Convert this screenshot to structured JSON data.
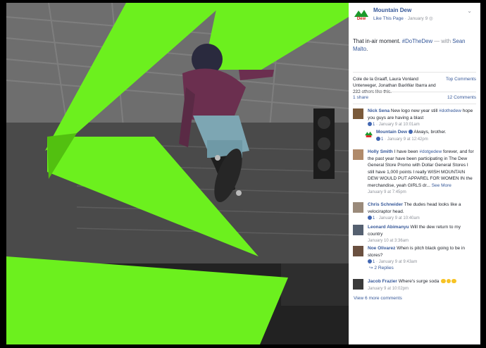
{
  "post": {
    "page_name": "Mountain Dew",
    "like_page": "Like This Page",
    "date": "January 9",
    "text_main": "That in-air moment. ",
    "hashtag": "#DoTheDew",
    "with_prefix": " — with ",
    "with_name": "Sean Malto",
    "text_end": ".",
    "reactions_text": "Cole de la Graaff, Laura Vonland Unterweger, Jonathan BaxWar Ibarra and 232 others like this.",
    "top_comments": "Top Comments",
    "shares": "1 share",
    "comments_count": "12 Comments"
  },
  "comments": [
    {
      "name": "Nick Sena",
      "text_pre": "New logo new year still ",
      "tag": "#dothedew",
      "text_post": " hope you guys are having a blast",
      "likes": "1",
      "time": "January 9 at 10:01am"
    },
    {
      "name": "Mountain Dew",
      "text_pre": "Always, brother.",
      "tag": "",
      "text_post": "",
      "likes": "1",
      "time": "January 9 at 12:42pm"
    },
    {
      "name": "Holly Smith",
      "text_pre": "I have been ",
      "tag": "#dotgedew",
      "text_post": " forever, and for the past year have been participating in The Dew General Store Promo with Dollar General Stores I still have 1,000 points I really WISH MOUNTAIN DEW WOULD PUT APPAREL FOR WOMEN IN the merchandise, yeah GIRLS dr...",
      "see_more": "See More",
      "time": "January 9 at 7:45pm"
    },
    {
      "name": "Chris Schneider",
      "text_pre": "The dudes head looks like a velociraptor head.",
      "tag": "",
      "text_post": "",
      "likes": "1",
      "time": "January 9 at 10:40am"
    },
    {
      "name": "Leonard Abimanyu",
      "text_pre": "Will the dew return to my country",
      "tag": "",
      "text_post": "",
      "time": "January 10 at 3:36am"
    },
    {
      "name": "Noe Olivarez",
      "text_pre": "When is pitch black going to be in stores?",
      "tag": "",
      "text_post": "",
      "likes": "1",
      "time": "January 9 at 9:43am"
    },
    {
      "name": "Jacob Frazier",
      "text_pre": "Where's surge soda",
      "tag": "",
      "text_post": "",
      "time": "January 9 at 10:02pm"
    }
  ],
  "replies_label": "2 Replies",
  "view_more": "View 6 more comments",
  "colors": {
    "green": "#6cf01e",
    "link": "#365899",
    "meta": "#90949c"
  }
}
